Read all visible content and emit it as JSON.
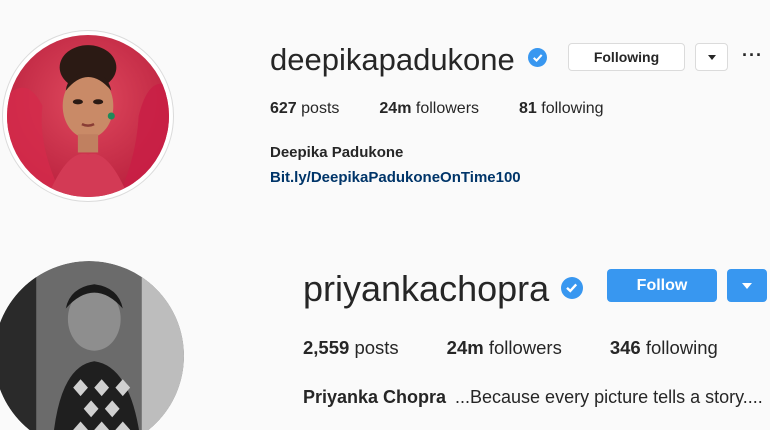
{
  "profiles": [
    {
      "username": "deepikapadukone",
      "verified": true,
      "follow_button": "Following",
      "more_icon": "more-dots-icon",
      "stats": {
        "posts_count": "627",
        "posts_label": "posts",
        "followers_count": "24m",
        "followers_label": "followers",
        "following_count": "81",
        "following_label": "following"
      },
      "full_name": "Deepika Padukone",
      "link": "Bit.ly/DeepikaPadukoneOnTime100"
    },
    {
      "username": "priyankachopra",
      "verified": true,
      "follow_button": "Follow",
      "stats": {
        "posts_count": "2,559",
        "posts_label": "posts",
        "followers_count": "24m",
        "followers_label": "followers",
        "following_count": "346",
        "following_label": "following"
      },
      "full_name": "Priyanka Chopra",
      "bio": "...Because every picture tells a story...."
    }
  ],
  "colors": {
    "accent_blue": "#3897f0",
    "link_blue": "#003569",
    "text": "#262626",
    "border": "#dbdbdb",
    "background": "#fafafa"
  }
}
